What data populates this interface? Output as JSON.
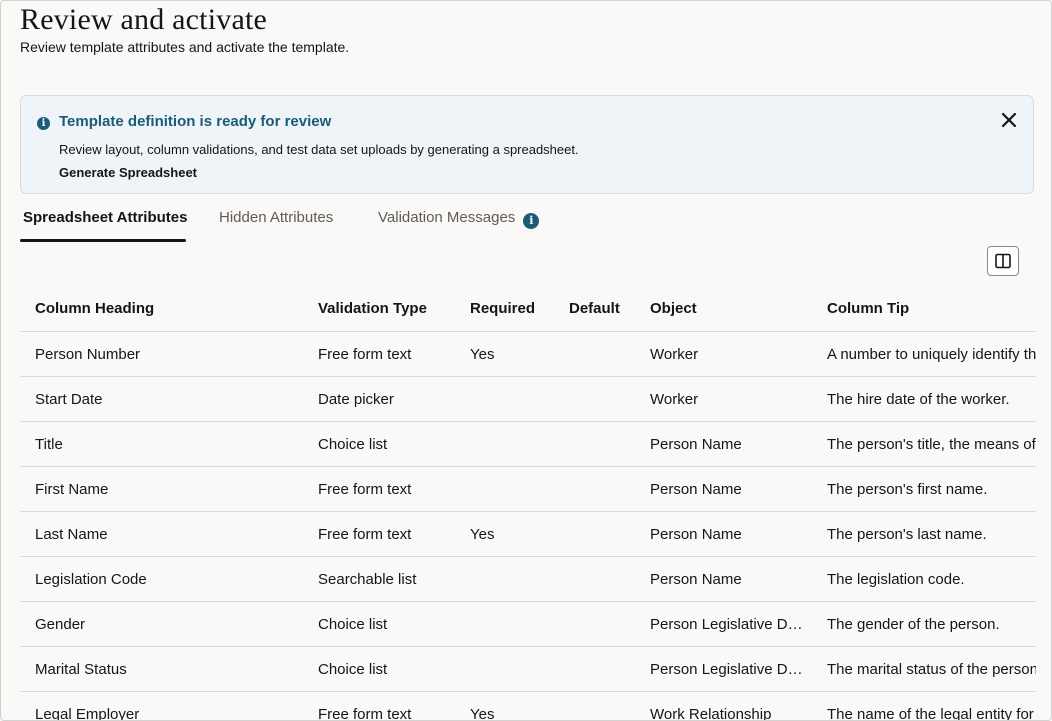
{
  "page": {
    "title": "Review and activate",
    "subtitle": "Review template attributes and activate the template."
  },
  "banner": {
    "title": "Template definition is ready for review",
    "text": "Review layout, column validations, and test data set uploads by generating a spreadsheet.",
    "link": "Generate Spreadsheet"
  },
  "tabs": [
    {
      "label": "Spreadsheet Attributes",
      "active": true
    },
    {
      "label": "Hidden Attributes",
      "active": false
    },
    {
      "label": "Validation Messages",
      "active": false
    }
  ],
  "table": {
    "headers": [
      "Column Heading",
      "Validation Type",
      "Required",
      "Default",
      "Object",
      "Column Tip"
    ],
    "rows": [
      [
        "Person Number",
        "Free form text",
        "Yes",
        "",
        "Worker",
        "A number to uniquely identify the worker."
      ],
      [
        "Start Date",
        "Date picker",
        "",
        "",
        "Worker",
        "The hire date of the worker."
      ],
      [
        "Title",
        "Choice list",
        "",
        "",
        "Person Name",
        "The person's title, the means of address."
      ],
      [
        "First Name",
        "Free form text",
        "",
        "",
        "Person Name",
        "The person's first name."
      ],
      [
        "Last Name",
        "Free form text",
        "Yes",
        "",
        "Person Name",
        "The person's last name."
      ],
      [
        "Legislation Code",
        "Searchable list",
        "",
        "",
        "Person Name",
        "The legislation code."
      ],
      [
        "Gender",
        "Choice list",
        "",
        "",
        "Person Legislative Data",
        "The gender of the person."
      ],
      [
        "Marital Status",
        "Choice list",
        "",
        "",
        "Person Legislative Data",
        "The marital status of the person."
      ],
      [
        "Legal Employer",
        "Free form text",
        "Yes",
        "",
        "Work Relationship",
        "The name of the legal entity for the employer."
      ]
    ]
  },
  "colors": {
    "accent": "#1a5b7a",
    "banner_bg": "#eef4f7",
    "text": "#161513"
  },
  "icons": {
    "banner": "info-icon",
    "close": "close-icon",
    "tab_info": "info-icon",
    "columns": "columns-icon"
  }
}
